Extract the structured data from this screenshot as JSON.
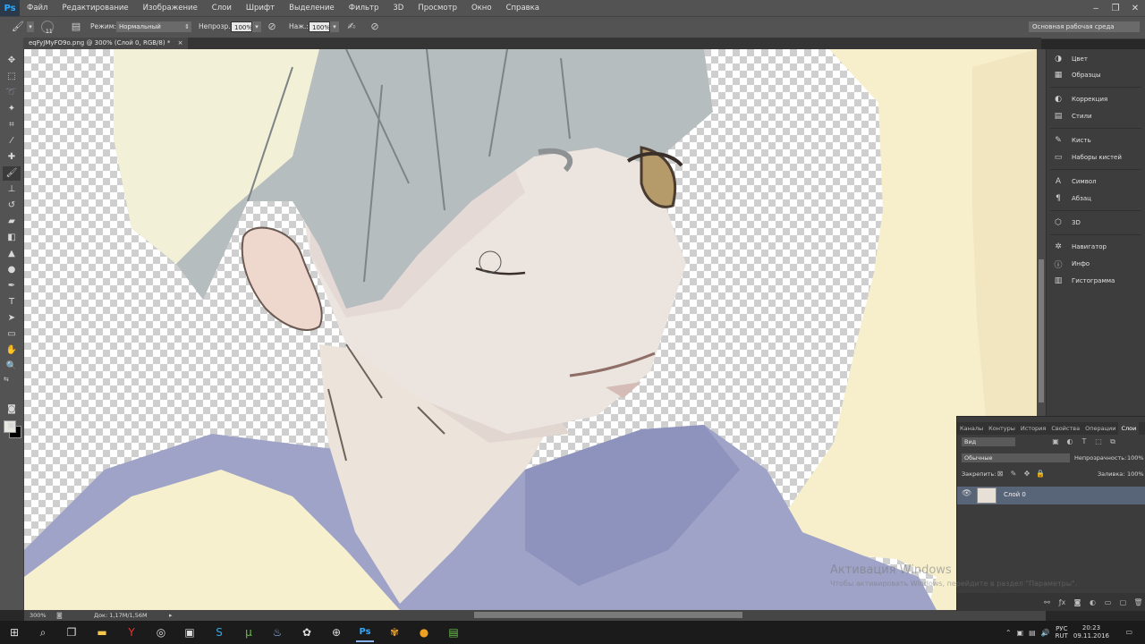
{
  "app": {
    "logo": "Ps"
  },
  "menu": [
    "Файл",
    "Редактирование",
    "Изображение",
    "Слои",
    "Шрифт",
    "Выделение",
    "Фильтр",
    "3D",
    "Просмотр",
    "Окно",
    "Справка"
  ],
  "window_controls": {
    "minimize": "‒",
    "restore": "❐",
    "close": "✕"
  },
  "options": {
    "brush_size": "11",
    "mode_label": "Режим:",
    "mode_value": "Нормальный",
    "opacity_label": "Непрозр.:",
    "opacity_value": "100%",
    "flow_label": "Наж.:",
    "flow_value": "100%",
    "workspace": "Основная рабочая среда"
  },
  "document": {
    "tab_title": "eqFyJMyFO9o.png @ 300% (Слой 0, RGB/8) *",
    "close": "×"
  },
  "status": {
    "zoom": "300%",
    "doc_info": "Док: 1,17M/1,56M"
  },
  "panels": {
    "dock": [
      {
        "icon": "color-icon",
        "glyph": "◑",
        "label": "Цвет"
      },
      {
        "icon": "swatches-icon",
        "glyph": "▦",
        "label": "Образцы"
      },
      {
        "icon": "adjustments-icon",
        "glyph": "◐",
        "label": "Коррекция"
      },
      {
        "icon": "styles-icon",
        "glyph": "▤",
        "label": "Стили"
      },
      {
        "icon": "brush-icon",
        "glyph": "✎",
        "label": "Кисть"
      },
      {
        "icon": "brush-presets-icon",
        "glyph": "▭",
        "label": "Наборы кистей"
      },
      {
        "icon": "character-icon",
        "glyph": "A",
        "label": "Символ"
      },
      {
        "icon": "paragraph-icon",
        "glyph": "¶",
        "label": "Абзац"
      },
      {
        "icon": "3d-icon",
        "glyph": "⬡",
        "label": "3D"
      },
      {
        "icon": "navigator-icon",
        "glyph": "✲",
        "label": "Навигатор"
      },
      {
        "icon": "info-icon",
        "glyph": "ⓘ",
        "label": "Инфо"
      },
      {
        "icon": "histogram-icon",
        "glyph": "▥",
        "label": "Гистограмма"
      }
    ]
  },
  "layers_panel": {
    "tabs": [
      "Каналы",
      "Контуры",
      "История",
      "Свойства",
      "Операции",
      "Слои"
    ],
    "filter_kind": "Вид",
    "blend_mode": "Обычные",
    "opacity_label": "Непрозрачность:",
    "opacity_value": "100%",
    "lock_label": "Закрепить:",
    "fill_label": "Заливка:",
    "fill_value": "100%",
    "layer_name": "Слой 0"
  },
  "watermark": {
    "line1": "Активация Windows",
    "line2": "Чтобы активировать Windows, перейдите в раздел \"Параметры\"."
  },
  "taskbar": {
    "lang": [
      "РУС",
      "RUT"
    ],
    "time": "20:23",
    "date": "09.11.2016"
  },
  "colors": {
    "foreground": "#e8e8e0",
    "background": "#000000",
    "accent": "#31a8ff"
  }
}
